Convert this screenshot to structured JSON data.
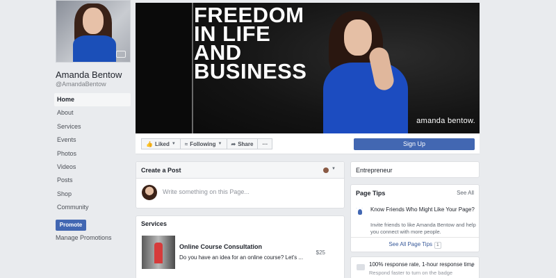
{
  "profile": {
    "name": "Amanda Bentow",
    "handle": "@AmandaBentow"
  },
  "nav": {
    "items": [
      {
        "label": "Home",
        "active": true
      },
      {
        "label": "About"
      },
      {
        "label": "Services"
      },
      {
        "label": "Events"
      },
      {
        "label": "Photos"
      },
      {
        "label": "Videos"
      },
      {
        "label": "Posts"
      },
      {
        "label": "Shop"
      },
      {
        "label": "Community"
      }
    ],
    "promote_label": "Promote",
    "manage_promotions_label": "Manage Promotions"
  },
  "cover": {
    "headline": [
      "FREEDOM",
      "IN LIFE",
      "AND",
      "BUSINESS"
    ],
    "brand": "amanda bentow."
  },
  "actions": {
    "liked_label": "Liked",
    "following_label": "Following",
    "share_label": "Share",
    "more_label": "···",
    "signup_label": "Sign Up"
  },
  "create_post": {
    "title": "Create a Post",
    "placeholder": "Write something on this Page..."
  },
  "services": {
    "title": "Services",
    "items": [
      {
        "title": "Online Course Consultation",
        "description": "Do you have an idea for an online course? Let's ...",
        "price": "$25"
      }
    ]
  },
  "right": {
    "category": "Entrepreneur",
    "page_tips": {
      "title": "Page Tips",
      "see_all": "See All",
      "tip_heading": "Know Friends Who Might Like Your Page?",
      "tip_body": "Invite friends to like Amanda Bentow and help you connect with more people.",
      "see_all_tips": "See All Page Tips",
      "count": "1"
    },
    "response": {
      "text": "100% response rate, 1-hour response time",
      "sub": "Respond faster to turn on the badge"
    }
  },
  "colors": {
    "accent": "#4267b2",
    "background": "#e9ebee",
    "cover_dress": "#1c4cc0"
  }
}
